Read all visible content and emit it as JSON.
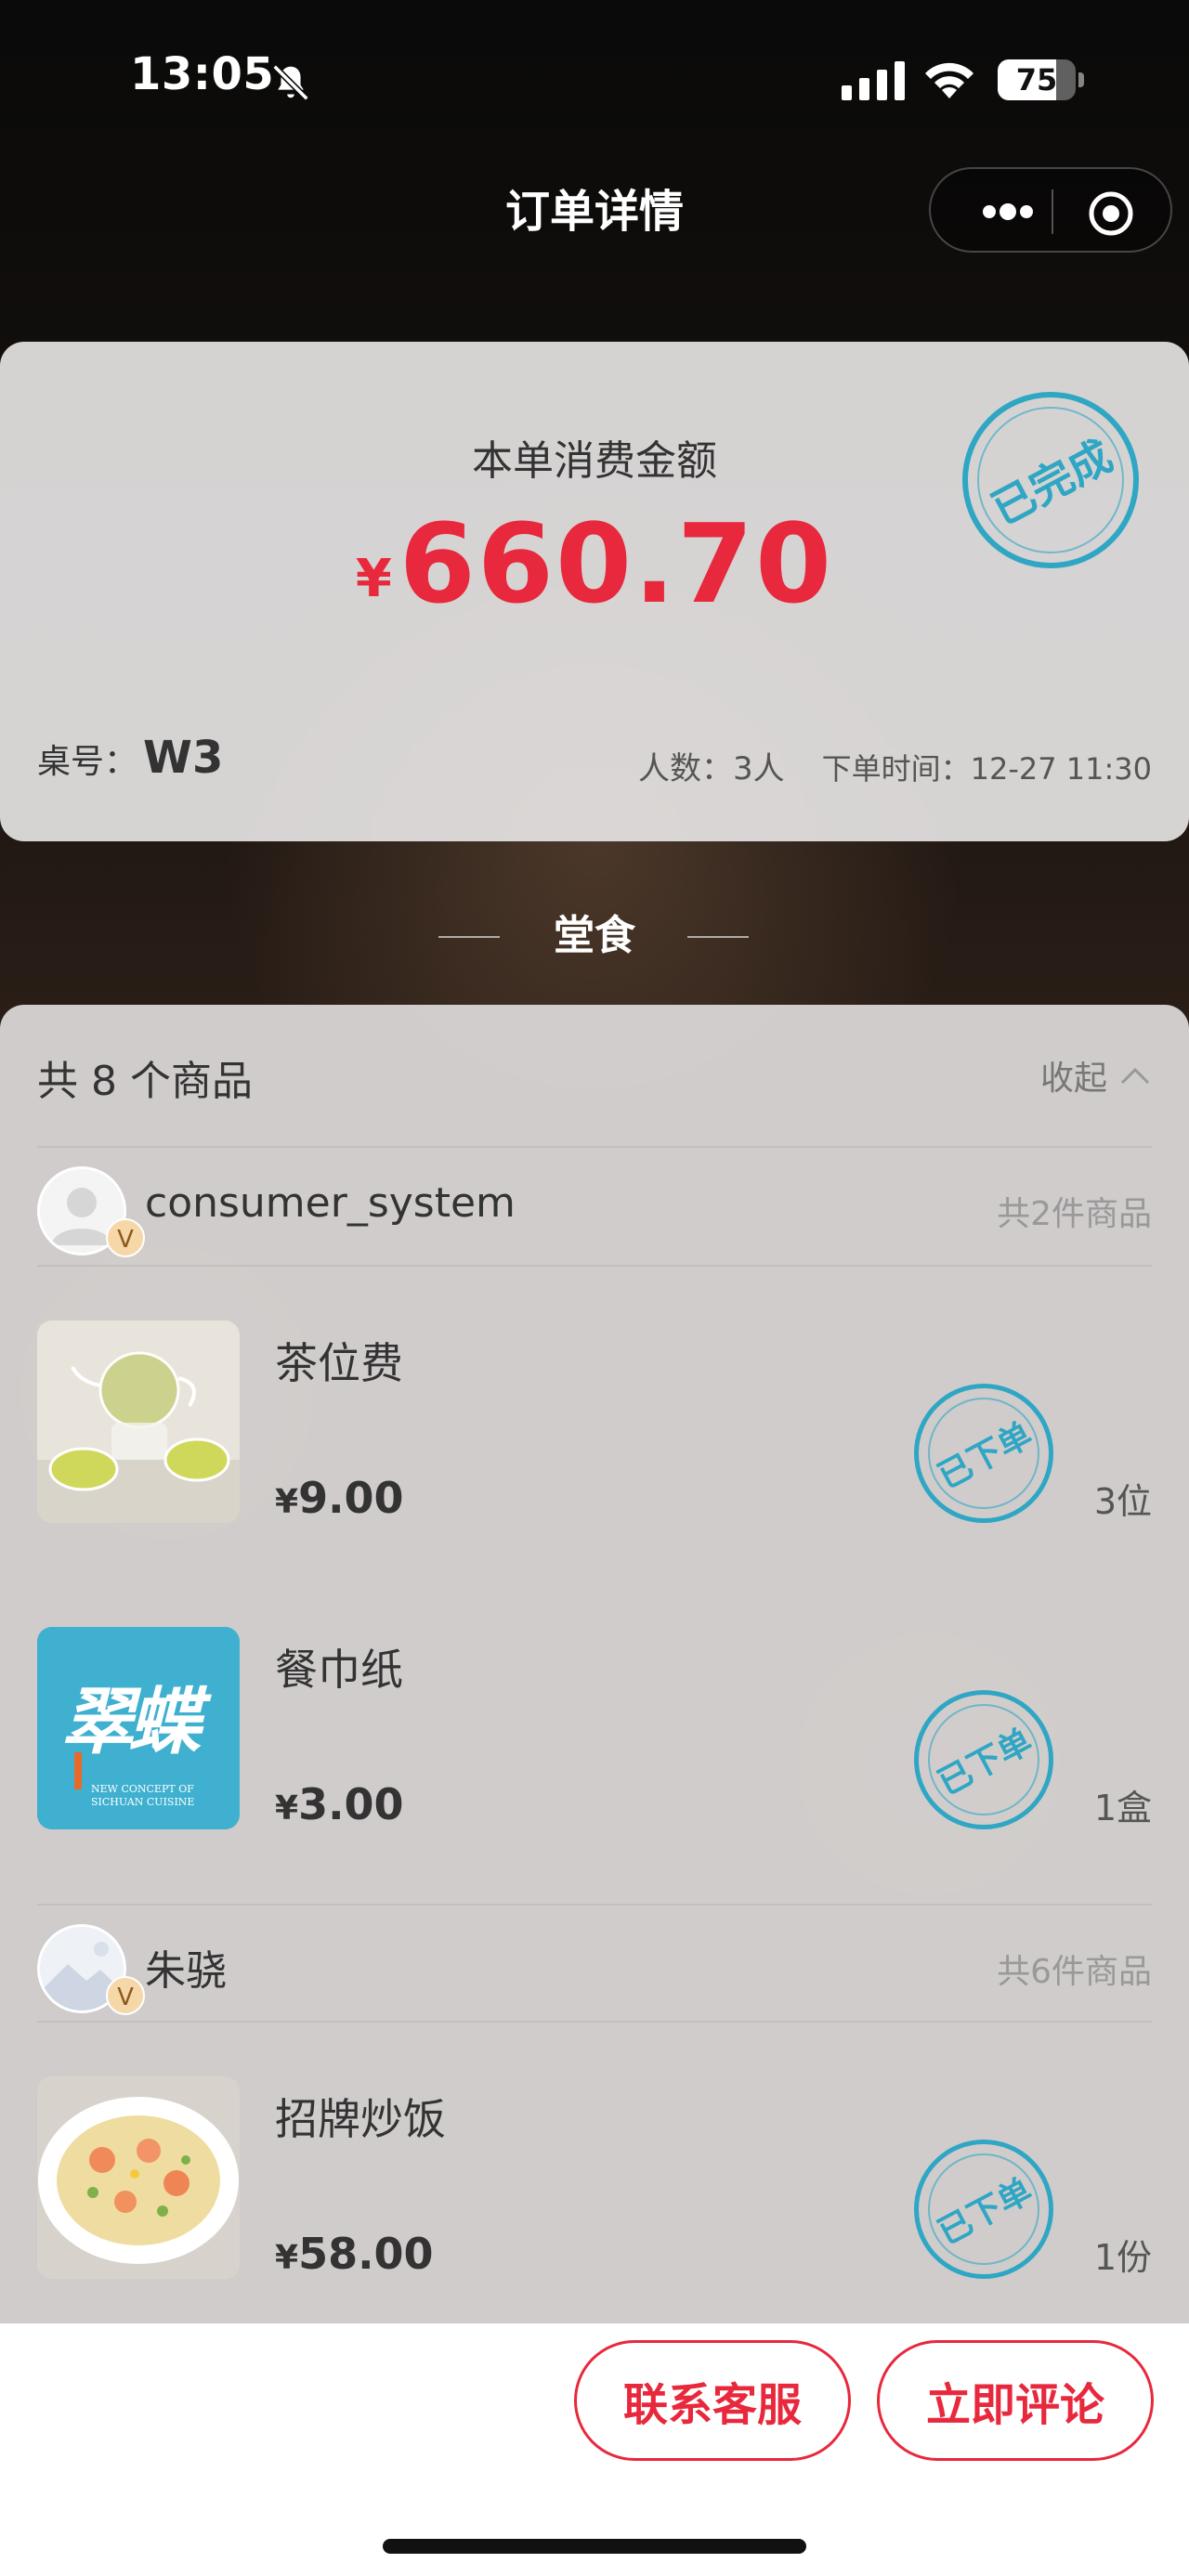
{
  "status_bar": {
    "time": "13:05",
    "battery": "75",
    "battery_level": 0.75
  },
  "nav": {
    "title": "订单详情"
  },
  "summary": {
    "amount_label": "本单消费金额",
    "currency": "¥",
    "amount": "660.70",
    "status_stamp": "已完成",
    "table_label": "桌号：",
    "table_value": "W3",
    "people": "人数：3人",
    "order_time": "下单时间：12-27 11:30"
  },
  "section": {
    "title": "堂食"
  },
  "items": {
    "count_text": "共 8 个商品",
    "collapse_label": "收起",
    "groups": [
      {
        "user": "consumer_system",
        "badge": "V",
        "total": "共2件商品",
        "products": [
          {
            "name": "茶位费",
            "currency": "¥",
            "price": "9.00",
            "stamp": "已下单",
            "qty": "3位"
          },
          {
            "name": "餐巾纸",
            "currency": "¥",
            "price": "3.00",
            "stamp": "已下单",
            "qty": "1盒"
          }
        ]
      },
      {
        "user": "朱骁",
        "badge": "V",
        "total": "共6件商品",
        "products": [
          {
            "name": "招牌炒饭",
            "currency": "¥",
            "price": "58.00",
            "stamp": "已下单",
            "qty": "1份"
          }
        ]
      }
    ],
    "logo_text": {
      "main": "翠蝶",
      "sub": "NEW CONCEPT OF SICHUAN CUISINE"
    }
  },
  "actions": {
    "contact": "联系客服",
    "review": "立即评论"
  },
  "colors": {
    "accent": "#e8283c",
    "stamp": "#2ea6c4"
  }
}
